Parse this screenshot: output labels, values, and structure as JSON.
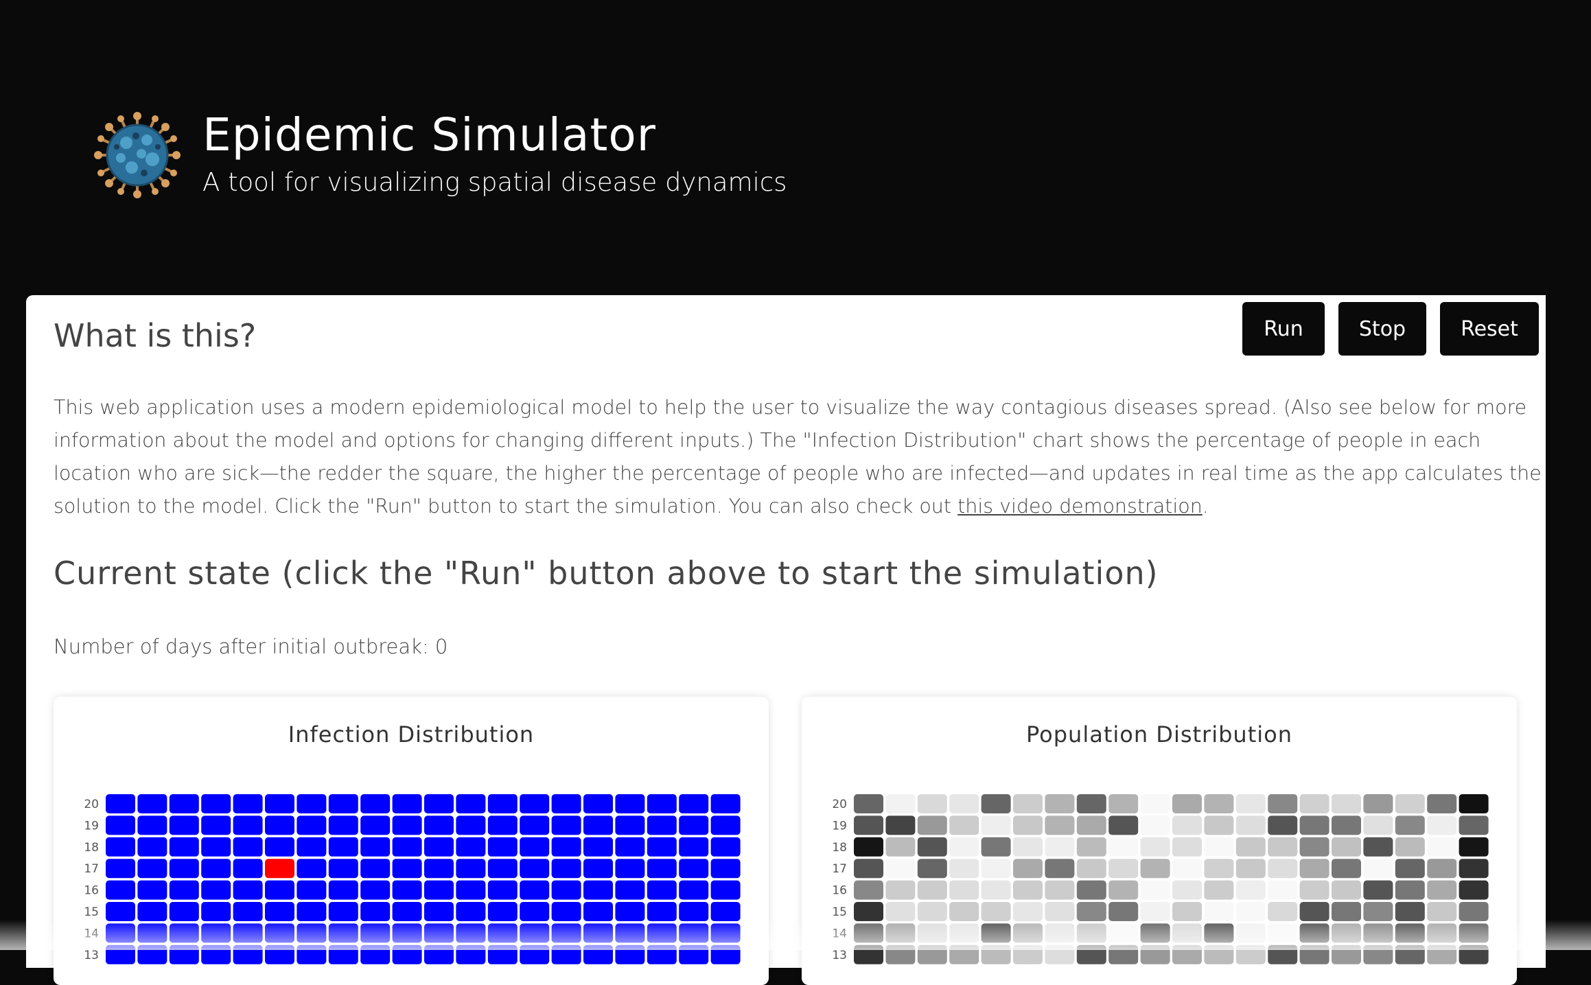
{
  "header": {
    "title": "Epidemic Simulator",
    "subtitle": "A tool for visualizing spatial disease dynamics",
    "logo_icon": "virus-logo-icon"
  },
  "controls": {
    "run_label": "Run",
    "stop_label": "Stop",
    "reset_label": "Reset"
  },
  "intro": {
    "heading": "What is this?",
    "text_before_link": "This web application uses a modern epidemiological model to help the user to visualize the way contagious diseases spread. (Also see below for more information about the model and options for changing different inputs.) The \"Infection Distribution\" chart shows the percentage of people in each location who are sick—the redder the square, the higher the percentage of people who are infected—and updates in real time as the app calculates the solution to the model. Click the \"Run\" button to start the simulation. You can also check out ",
    "link_text": "this video demonstration",
    "text_after_link": "."
  },
  "state": {
    "heading": "Current state (click the \"Run\" button above to start the simulation)",
    "days_text": "Number of days after initial outbreak: 0"
  },
  "colors": {
    "background": "#0a0a0a",
    "healthy_cell": "#0000ff",
    "infected_cell": "#ff0000"
  },
  "chart_data": [
    {
      "type": "heatmap",
      "title": "Infection Distribution",
      "y_ticks": [
        "20",
        "19",
        "18",
        "17",
        "16",
        "15",
        "14",
        "13"
      ],
      "columns": 20,
      "infected_cells": [
        {
          "row": "17",
          "col": 5
        }
      ]
    },
    {
      "type": "heatmap",
      "title": "Population Distribution",
      "y_ticks": [
        "20",
        "19",
        "18",
        "17",
        "16",
        "15",
        "14",
        "13"
      ],
      "columns": 20,
      "shades": [
        [
          "#666666",
          "#f2f2f2",
          "#d9d9d9",
          "#e6e6e6",
          "#666666",
          "#cccccc",
          "#b3b3b3",
          "#666666",
          "#b3b3b3",
          "#f8f8f8",
          "#aaaaaa",
          "#b3b3b3",
          "#e6e6e6",
          "#888888",
          "#d0d0d0",
          "#d9d9d9",
          "#999999",
          "#d0d0d0",
          "#777777",
          "#111111"
        ],
        [
          "#555555",
          "#444444",
          "#999999",
          "#cccccc",
          "#eeeeee",
          "#c8c8c8",
          "#b3b3b3",
          "#aaaaaa",
          "#555555",
          "#f8f8f8",
          "#e0e0e0",
          "#c8c8c8",
          "#dddddd",
          "#555555",
          "#777777",
          "#777777",
          "#e0e0e0",
          "#888888",
          "#eeeeee",
          "#666666"
        ],
        [
          "#151515",
          "#bbbbbb",
          "#555555",
          "#f2f2f2",
          "#777777",
          "#e6e6e6",
          "#eeeeee",
          "#bbbbbb",
          "#f8f8f8",
          "#e6e6e6",
          "#dddddd",
          "#f8f8f8",
          "#c8c8c8",
          "#c8c8c8",
          "#888888",
          "#c0c0c0",
          "#555555",
          "#bbbbbb",
          "#f8f8f8",
          "#151515"
        ],
        [
          "#555555",
          "#f8f8f8",
          "#666666",
          "#e6e6e6",
          "#f2f2f2",
          "#aaaaaa",
          "#777777",
          "#c8c8c8",
          "#d9d9d9",
          "#b3b3b3",
          "#f8f8f8",
          "#d0d0d0",
          "#c8c8c8",
          "#dddddd",
          "#aaaaaa",
          "#777777",
          "#f8f8f8",
          "#666666",
          "#999999",
          "#333333"
        ],
        [
          "#888888",
          "#cccccc",
          "#cccccc",
          "#dddddd",
          "#e6e6e6",
          "#cccccc",
          "#cccccc",
          "#777777",
          "#b3b3b3",
          "#f8f8f8",
          "#e6e6e6",
          "#cccccc",
          "#eeeeee",
          "#f8f8f8",
          "#cccccc",
          "#c8c8c8",
          "#555555",
          "#777777",
          "#aaaaaa",
          "#333333"
        ],
        [
          "#333333",
          "#e0e0e0",
          "#d9d9d9",
          "#cccccc",
          "#d0d0d0",
          "#e6e6e6",
          "#e0e0e0",
          "#888888",
          "#777777",
          "#f2f2f2",
          "#cccccc",
          "#f8f8f8",
          "#f8f8f8",
          "#d9d9d9",
          "#555555",
          "#777777",
          "#888888",
          "#555555",
          "#c8c8c8",
          "#777777"
        ],
        [
          "#666666",
          "#aaaaaa",
          "#dddddd",
          "#e6e6e6",
          "#555555",
          "#b3b3b3",
          "#e6e6e6",
          "#c8c8c8",
          "#f8f8f8",
          "#666666",
          "#d9d9d9",
          "#555555",
          "#f2f2f2",
          "#f8f8f8",
          "#555555",
          "#aaaaaa",
          "#888888",
          "#555555",
          "#aaaaaa",
          "#666666"
        ],
        [
          "#333333",
          "#888888",
          "#999999",
          "#aaaaaa",
          "#bbbbbb",
          "#cccccc",
          "#dddddd",
          "#555555",
          "#777777",
          "#999999",
          "#aaaaaa",
          "#bbbbbb",
          "#cccccc",
          "#555555",
          "#777777",
          "#999999",
          "#888888",
          "#666666",
          "#aaaaaa",
          "#444444"
        ]
      ]
    }
  ]
}
